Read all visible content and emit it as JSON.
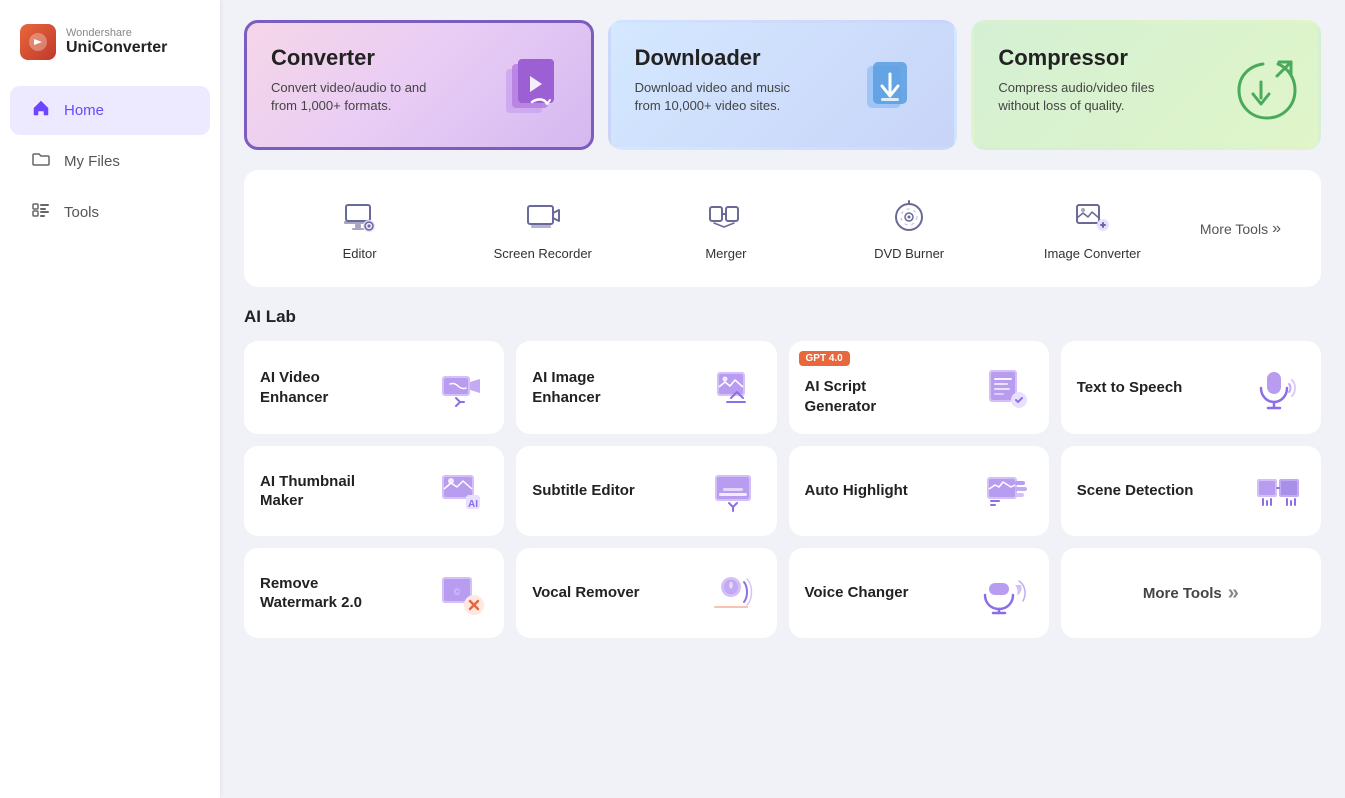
{
  "app": {
    "brand": "Wondershare",
    "product": "UniConverter"
  },
  "sidebar": {
    "items": [
      {
        "id": "home",
        "label": "Home",
        "icon": "🏠",
        "active": true
      },
      {
        "id": "my-files",
        "label": "My Files",
        "icon": "🗂",
        "active": false
      },
      {
        "id": "tools",
        "label": "Tools",
        "icon": "🧰",
        "active": false
      }
    ]
  },
  "top_cards": [
    {
      "id": "converter",
      "title": "Converter",
      "desc": "Convert video/audio to and from 1,000+ formats.",
      "style": "converter"
    },
    {
      "id": "downloader",
      "title": "Downloader",
      "desc": "Download video and music from 10,000+ video sites.",
      "style": "downloader"
    },
    {
      "id": "compressor",
      "title": "Compressor",
      "desc": "Compress audio/video files without loss of quality.",
      "style": "compressor"
    }
  ],
  "tools_row": {
    "items": [
      {
        "id": "editor",
        "label": "Editor"
      },
      {
        "id": "screen-recorder",
        "label": "Screen Recorder"
      },
      {
        "id": "merger",
        "label": "Merger"
      },
      {
        "id": "dvd-burner",
        "label": "DVD Burner"
      },
      {
        "id": "image-converter",
        "label": "Image Converter"
      }
    ],
    "more_tools_label": "More Tools"
  },
  "ai_lab": {
    "title": "AI Lab",
    "items": [
      {
        "id": "ai-video-enhancer",
        "label": "AI Video\nEnhancer",
        "badge": null
      },
      {
        "id": "ai-image-enhancer",
        "label": "AI Image\nEnhancer",
        "badge": null
      },
      {
        "id": "ai-script-generator",
        "label": "AI Script\nGenerator",
        "badge": "GPT 4.0"
      },
      {
        "id": "text-to-speech",
        "label": "Text to Speech",
        "badge": null
      },
      {
        "id": "ai-thumbnail-maker",
        "label": "AI Thumbnail\nMaker",
        "badge": null
      },
      {
        "id": "subtitle-editor",
        "label": "Subtitle Editor",
        "badge": null
      },
      {
        "id": "auto-highlight",
        "label": "Auto Highlight",
        "badge": null
      },
      {
        "id": "scene-detection",
        "label": "Scene Detection",
        "badge": null
      },
      {
        "id": "remove-watermark",
        "label": "Remove\nWatermark 2.0",
        "badge": null
      },
      {
        "id": "vocal-remover",
        "label": "Vocal Remover",
        "badge": null
      },
      {
        "id": "voice-changer",
        "label": "Voice Changer",
        "badge": null
      },
      {
        "id": "more-tools",
        "label": "More Tools",
        "badge": null,
        "isMore": true
      }
    ]
  }
}
